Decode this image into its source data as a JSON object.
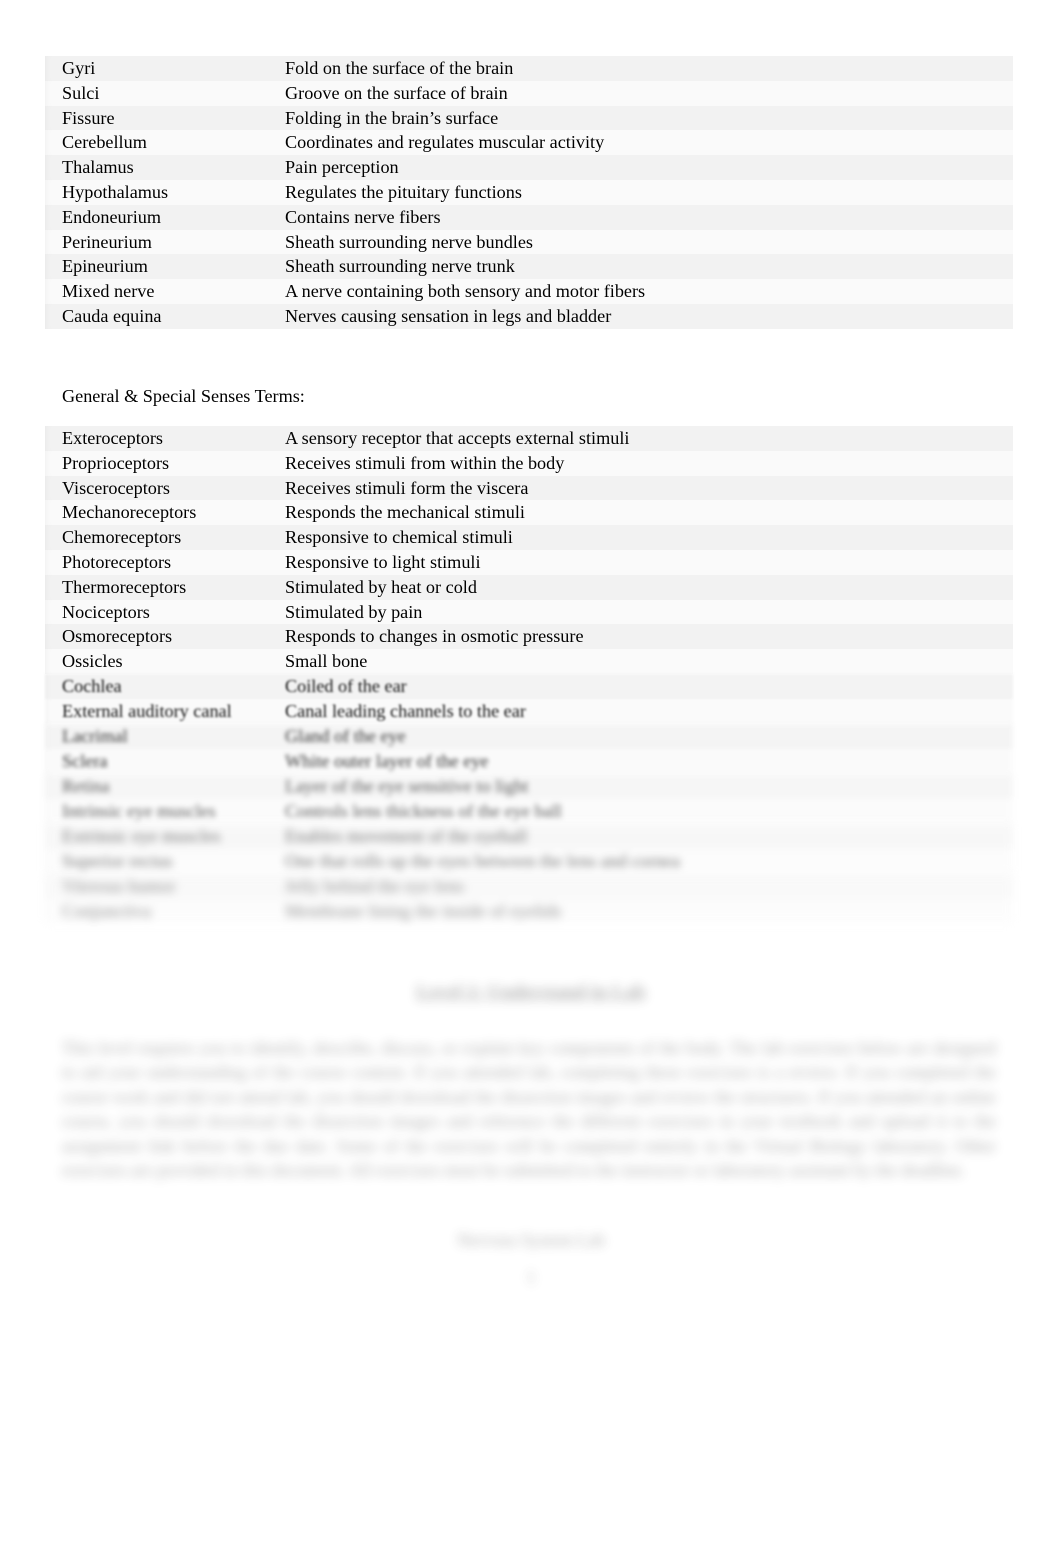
{
  "document": {
    "page_background": "#ffffff",
    "text_color": "#000000"
  },
  "nervous_table": {
    "rows": [
      {
        "term": "Gyri",
        "definition": "Fold on the surface of the brain"
      },
      {
        "term": "Sulci",
        "definition": "Groove on the surface of brain"
      },
      {
        "term": "Fissure",
        "definition": "Folding in the brain’s surface"
      },
      {
        "term": "Cerebellum",
        "definition": "Coordinates and regulates muscular activity"
      },
      {
        "term": "Thalamus",
        "definition": "Pain perception"
      },
      {
        "term": "Hypothalamus",
        "definition": "Regulates the pituitary functions"
      },
      {
        "term": "Endoneurium",
        "definition": "Contains nerve fibers"
      },
      {
        "term": "Perineurium",
        "definition": "Sheath surrounding nerve bundles"
      },
      {
        "term": "Epineurium",
        "definition": "Sheath surrounding nerve trunk"
      },
      {
        "term": "Mixed nerve",
        "definition": "A nerve containing both sensory and motor fibers"
      },
      {
        "term": "Cauda equina",
        "definition": "Nerves causing sensation in legs and bladder"
      }
    ]
  },
  "section_heading": {
    "label": "General & Special Senses Terms:"
  },
  "senses_table": {
    "rows": [
      {
        "term": "Exteroceptors",
        "definition": "A sensory receptor that accepts external stimuli"
      },
      {
        "term": "Proprioceptors",
        "definition": "Receives stimuli from within the body"
      },
      {
        "term": "Visceroceptors",
        "definition": "Receives stimuli form the viscera"
      },
      {
        "term": "Mechanoreceptors",
        "definition": "Responds the mechanical stimuli"
      },
      {
        "term": "Chemoreceptors",
        "definition": "Responsive to chemical stimuli"
      },
      {
        "term": "Photoreceptors",
        "definition": "Responsive to light stimuli"
      },
      {
        "term": "Thermoreceptors",
        "definition": "Stimulated by heat or cold"
      },
      {
        "term": "Nociceptors",
        "definition": "Stimulated by pain"
      },
      {
        "term": "Osmoreceptors",
        "definition": "Responds to changes in osmotic pressure"
      },
      {
        "term": "Ossicles",
        "definition": "Small bone"
      }
    ],
    "blurred_rows": [
      {
        "term": "Cochlea",
        "definition": "Coiled of the ear"
      },
      {
        "term": "External auditory canal",
        "definition": "Canal leading channels to the ear"
      },
      {
        "term": "Lacrimal",
        "definition": "Gland of the eye"
      },
      {
        "term": "Sclera",
        "definition": "White outer layer of the eye"
      },
      {
        "term": "Retina",
        "definition": "Layer of the eye sensitive to light"
      },
      {
        "term": "Intrinsic eye muscles",
        "definition": "Controls lens thickness of the eye ball"
      },
      {
        "term": "Extrinsic eye muscles",
        "definition": "Enables movement of the eyeball"
      },
      {
        "term": "Superior rectus",
        "definition": "One that rolls up the eyes between the lens and cornea"
      },
      {
        "term": "Vitreous humor",
        "definition": "Jelly behind the eye lens"
      },
      {
        "term": "Conjunctiva",
        "definition": "Membrane lining the inside of eyelids"
      }
    ]
  },
  "blurred_section": {
    "heading": "Level 2: Understand in Lab",
    "paragraph": "This level requires you to identify, describe, discuss, or explain key components of the body. The lab exercises below are designed to aid your understanding of the course content. If you attended lab, completing these exercises is a review. If you completed the course work and did not attend lab, you should download the dissection images and review the structures. If you attended an online course, you should download the dissection images and reference the different exercises in your textbook and upload it to the assignment link before the due date. Some of the exercises will be completed entirely in the Virtual Biology laboratory. Other exercises are provided in this document. All exercises must be submitted to the instructor or laboratory assistant by the deadline.",
    "footer": "Nervous System Lab",
    "page_number": "1"
  }
}
